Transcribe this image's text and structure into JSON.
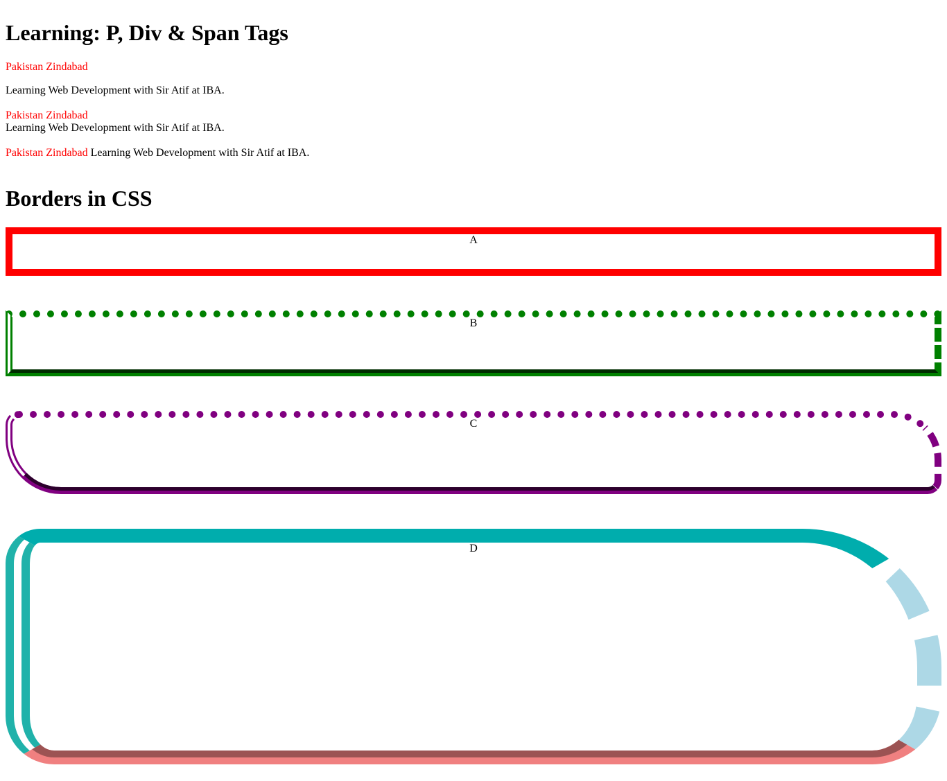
{
  "section1": {
    "heading": "Learning: P, Div & Span Tags",
    "p1_red": "Pakistan Zindabad",
    "p2": "Learning Web Development with Sir Atif at IBA.",
    "div_red": "Pakistan Zindabad",
    "div_text": "Learning Web Development with Sir Atif at IBA.",
    "span_red": "Pakistan Zindabad",
    "span_text": "Learning Web Development with Sir Atif at IBA."
  },
  "section2": {
    "heading": "Borders in CSS",
    "boxes": [
      {
        "label": "A"
      },
      {
        "label": "B"
      },
      {
        "label": "C"
      },
      {
        "label": "D"
      }
    ]
  },
  "colors": {
    "text_red": "#ff0000",
    "border_a": "#ff0000",
    "border_b": "#008000",
    "border_c": "#800080",
    "border_d_top": "#00adad",
    "border_d_right": "#add8e6",
    "border_d_bottom": "#f08080",
    "border_d_left": "#20b2aa"
  }
}
